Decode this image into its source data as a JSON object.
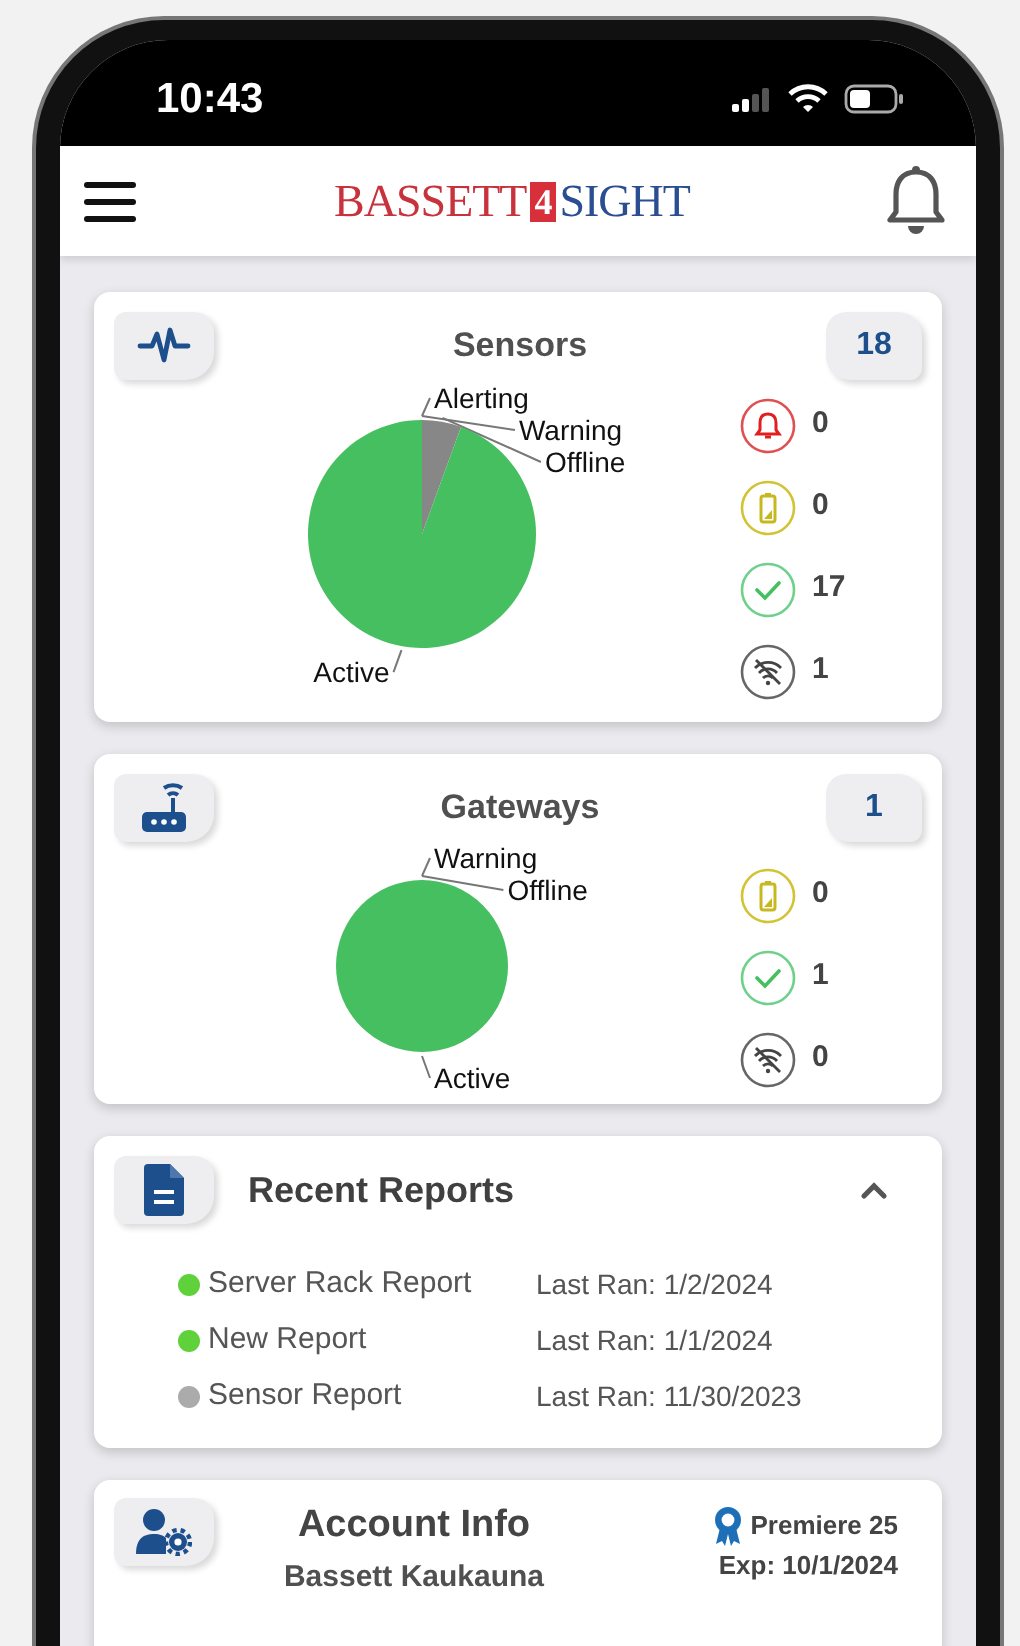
{
  "status_bar": {
    "time": "10:43"
  },
  "header": {
    "logo": {
      "brand": "BASSETT",
      "mark": "4",
      "product": "SIGHT"
    }
  },
  "sensors": {
    "title": "Sensors",
    "count": "18",
    "chart_data": {
      "type": "pie",
      "categories": [
        "Alerting",
        "Warning",
        "Offline",
        "Active"
      ],
      "series": [
        {
          "values": [
            0,
            0,
            5.56,
            94.44
          ],
          "colors": [
            "#e03c3c",
            "#d4c21f",
            "#878787",
            "#45bf5f"
          ]
        }
      ]
    },
    "statuses": [
      {
        "kind": "alert",
        "count": "0"
      },
      {
        "kind": "battery",
        "count": "0"
      },
      {
        "kind": "active",
        "count": "17"
      },
      {
        "kind": "offline",
        "count": "1"
      }
    ]
  },
  "gateways": {
    "title": "Gateways",
    "count": "1",
    "chart_data": {
      "type": "pie",
      "categories": [
        "Warning",
        "Offline",
        "Active"
      ],
      "series": [
        {
          "values": [
            0,
            0,
            100
          ],
          "colors": [
            "#d4c21f",
            "#878787",
            "#45bf5f"
          ]
        }
      ]
    },
    "statuses": [
      {
        "kind": "battery",
        "count": "0"
      },
      {
        "kind": "active",
        "count": "1"
      },
      {
        "kind": "offline",
        "count": "0"
      }
    ]
  },
  "recent_reports": {
    "title": "Recent Reports",
    "expanded": true,
    "reports": [
      {
        "name": "Server Rack Report",
        "last_ran": "Last Ran: 1/2/2024",
        "color": "#5fd13b"
      },
      {
        "name": "New Report",
        "last_ran": "Last Ran: 1/1/2024",
        "color": "#5fd13b"
      },
      {
        "name": "Sensor Report",
        "last_ran": "Last Ran: 11/30/2023",
        "color": "#ababab"
      }
    ]
  },
  "account_info": {
    "title": "Account Info",
    "name": "Bassett Kaukauna",
    "plan": "Premiere 25",
    "expiry": "Exp: 10/1/2024"
  }
}
